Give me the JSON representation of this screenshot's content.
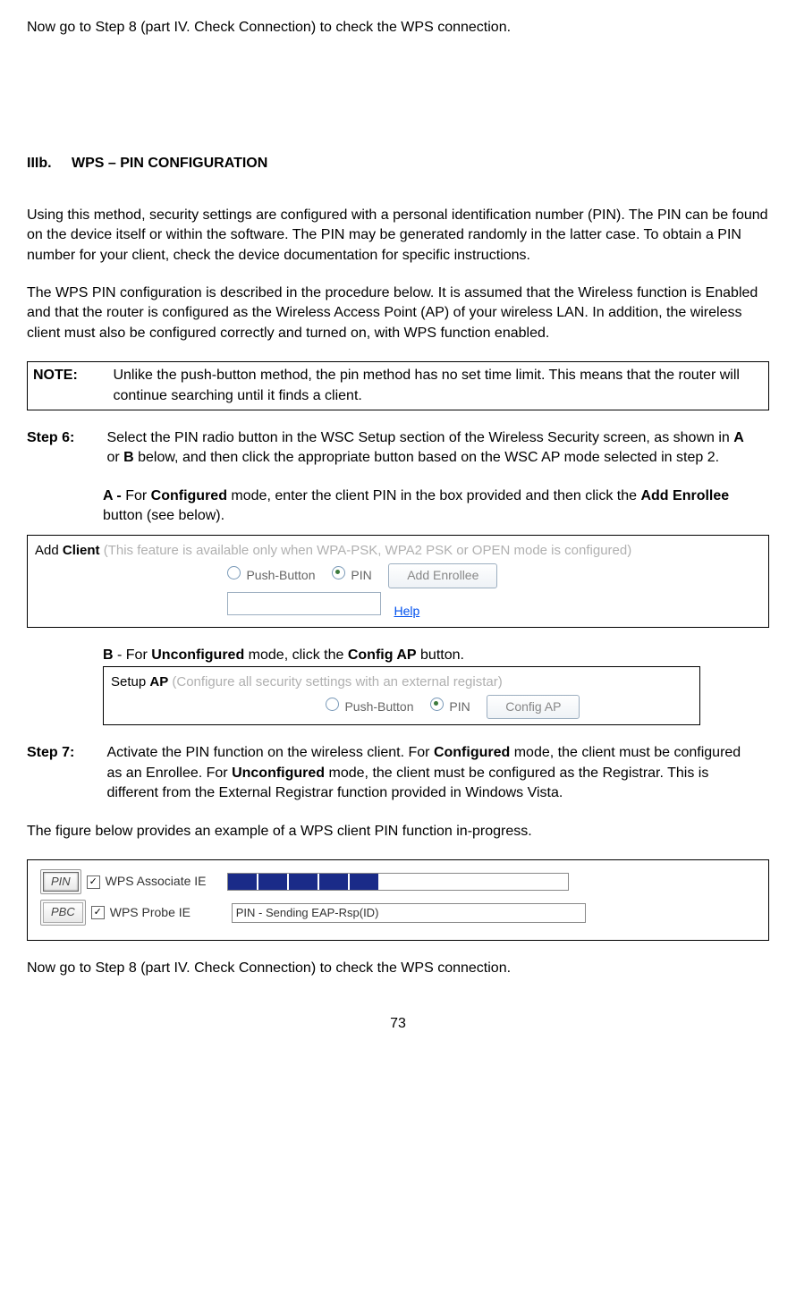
{
  "firstLine": "Now go to Step 8 (part IV. Check Connection) to check the WPS connection.",
  "section": {
    "num": "IIIb.",
    "title": "WPS – PIN CONFIGURATION"
  },
  "para1": "Using this method, security settings are configured with a personal identification number (PIN).   The PIN can be found on the device itself or within the software.   The PIN may be generated randomly in the latter case.   To obtain a PIN number for your client, check the device documentation for specific instructions.",
  "para2": "The WPS PIN configuration is described in the procedure below.   It is assumed that the Wireless function is Enabled and that the router is configured as the Wireless Access Point (AP) of your wireless LAN.   In addition, the wireless client must also be configured correctly and turned on, with WPS function enabled.",
  "note": {
    "label": "NOTE:",
    "text": "Unlike the push-button method, the pin method has no set time limit.   This means that the router will continue searching until it finds a client."
  },
  "step6": {
    "label": "Step 6:",
    "text_a": "Select the PIN radio button in the WSC Setup section of the Wireless Security screen, as shown in ",
    "text_b": " or ",
    "text_c": " below, and then click the appropriate button based on the WSC AP mode selected in step 2.",
    "A_prefix": "A - ",
    "A_text1": "For ",
    "A_bold1": "Configured",
    "A_text2": " mode, enter the client PIN in the box provided and then click the ",
    "A_bold2": "Add Enrollee",
    "A_text3": " button (see below).",
    "B_prefix": "B",
    "B_text1": " - For ",
    "B_bold1": "Unconfigured",
    "B_text2": " mode, click the ",
    "B_bold2": "Config AP",
    "B_text3": " button."
  },
  "figA": {
    "title_prefix": "Add ",
    "title_bold": "Client",
    "title_gray": " (This feature is available only when WPA-PSK, WPA2 PSK or OPEN mode is configured)",
    "radio1": "Push-Button",
    "radio2": "PIN",
    "button": "Add Enrollee",
    "help": "Help"
  },
  "figB": {
    "title_prefix": "Setup ",
    "title_bold": "AP",
    "title_gray": " (Configure all security settings with an external registar)",
    "radio1": "Push-Button",
    "radio2": "PIN",
    "button": "Config AP"
  },
  "step7": {
    "label": "Step 7:",
    "text1": "Activate the PIN function on the wireless client.   For ",
    "bold1": "Configured",
    "text2": " mode, the client must be configured as an Enrollee.   For ",
    "bold2": "Unconfigured",
    "text3": " mode, the client must be configured as the Registrar.   This is different from the External Registrar function provided in Windows Vista."
  },
  "para3": "The figure below provides an example of a WPS client PIN function in-progress.",
  "progress": {
    "pin_btn": "PIN",
    "pbc_btn": "PBC",
    "check1": "WPS Associate IE",
    "check2": "WPS Probe IE",
    "status": "PIN - Sending EAP-Rsp(ID)"
  },
  "lastLine": "Now go to Step 8 (part IV. Check Connection) to check the WPS connection.",
  "pageNum": "73"
}
